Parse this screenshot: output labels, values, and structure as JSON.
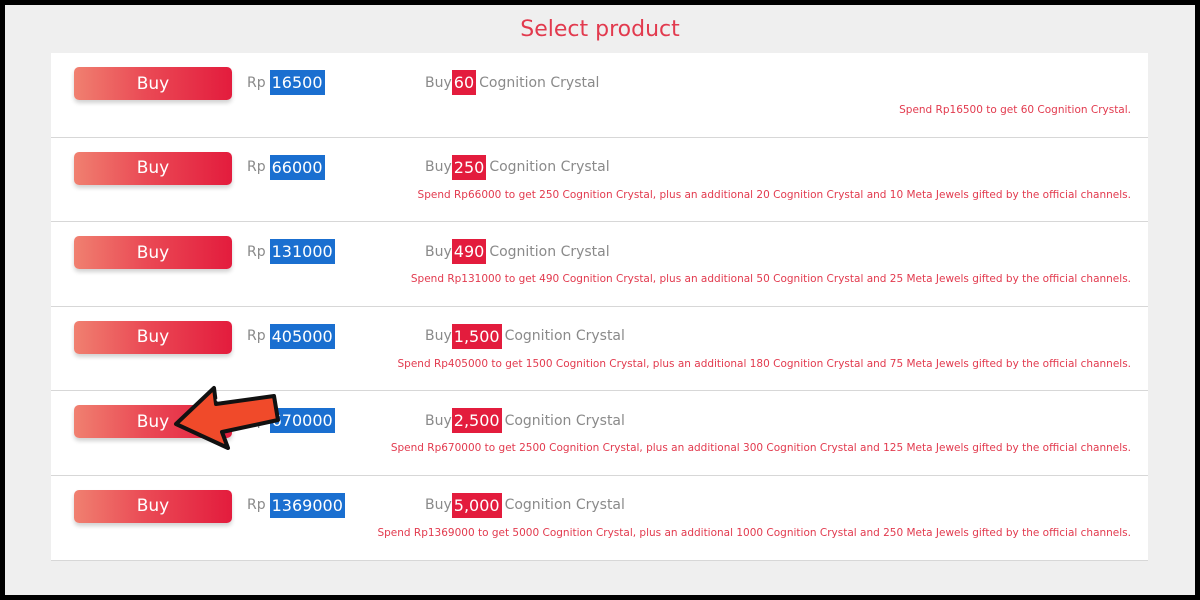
{
  "page_title": "Select product",
  "buy_label": "Buy",
  "currency_label": "Rp",
  "offer_prefix": "Buy",
  "item_name": "Cognition Crystal",
  "colors": {
    "title": "#e23a4e",
    "price_badge": "#1a6fd0",
    "quantity_badge": "#e31c3d",
    "detail_text": "#e23a4e",
    "pointer_arrow": "#f04a2a"
  },
  "overlay": {
    "icon": "left-pointing-arrow-icon"
  },
  "products": [
    {
      "price": "16500",
      "quantity": "60",
      "detail": "Spend Rp16500 to get 60 Cognition Crystal."
    },
    {
      "price": "66000",
      "quantity": "250",
      "detail": "Spend Rp66000 to get 250 Cognition Crystal, plus an additional 20 Cognition Crystal and 10 Meta Jewels gifted by the official channels."
    },
    {
      "price": "131000",
      "quantity": "490",
      "detail": "Spend Rp131000 to get 490 Cognition Crystal, plus an additional 50 Cognition Crystal and 25 Meta Jewels gifted by the official channels."
    },
    {
      "price": "405000",
      "quantity": "1,500",
      "detail": "Spend Rp405000 to get 1500 Cognition Crystal, plus an additional 180 Cognition Crystal and 75 Meta Jewels gifted by the official channels."
    },
    {
      "price": "670000",
      "quantity": "2,500",
      "detail": "Spend Rp670000 to get 2500 Cognition Crystal, plus an additional 300 Cognition Crystal and 125 Meta Jewels gifted by the official channels."
    },
    {
      "price": "1369000",
      "quantity": "5,000",
      "detail": "Spend Rp1369000 to get 5000 Cognition Crystal, plus an additional 1000 Cognition Crystal and 250 Meta Jewels gifted by the official channels."
    }
  ]
}
